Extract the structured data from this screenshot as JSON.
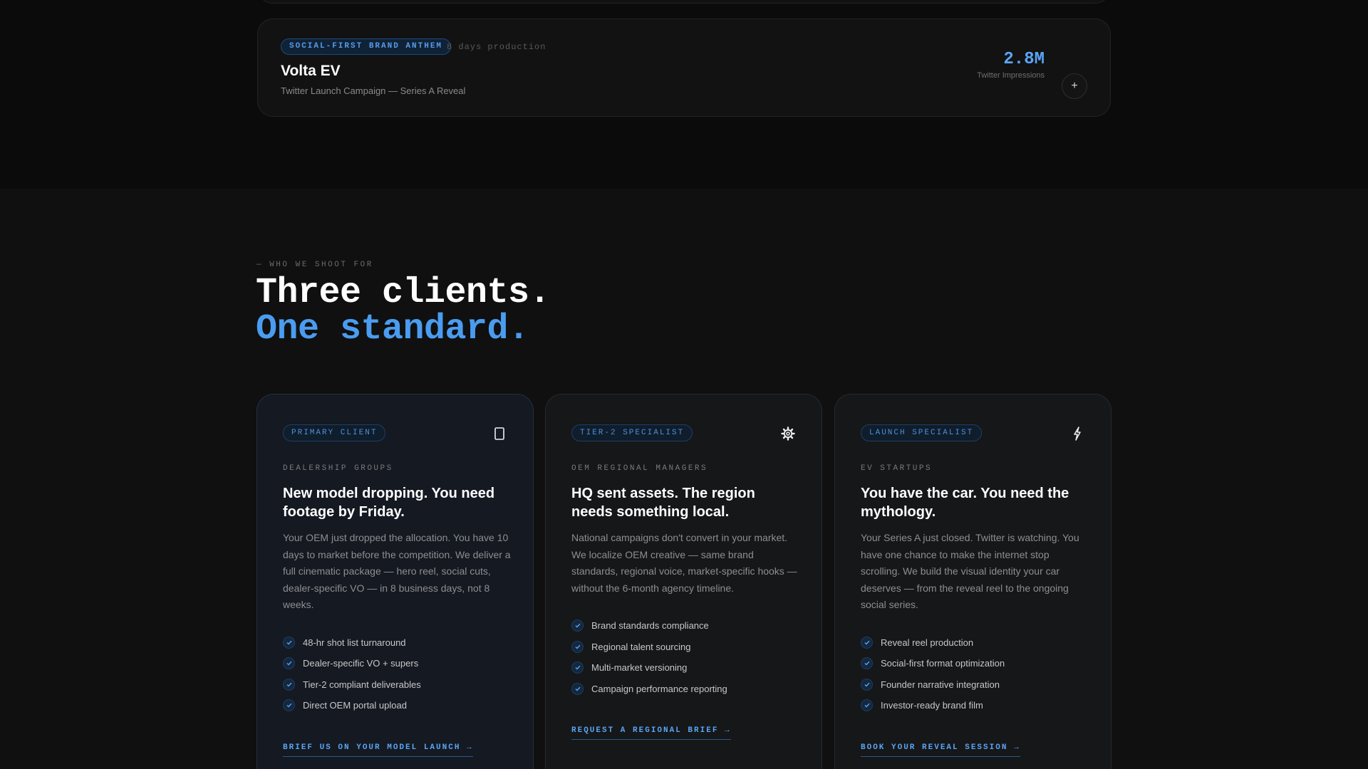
{
  "project": {
    "badge": "SOCIAL-FIRST BRAND ANTHEM",
    "meta": "8 days production",
    "title": "Volta EV",
    "subtitle": "Twitter Launch Campaign — Series A Reveal",
    "metric_value": "2.8M",
    "metric_label": "Twitter Impressions",
    "expand_icon": "plus-icon"
  },
  "section": {
    "eyebrow": "— WHO WE SHOOT FOR",
    "headline_line1": "Three clients.",
    "headline_line2": "One standard.",
    "accent_color": "#4a9cf0"
  },
  "clients": [
    {
      "tag": "PRIMARY CLIENT",
      "icon": "phone-icon",
      "eyebrow": "DEALERSHIP GROUPS",
      "title": "New model dropping. You need footage by Friday.",
      "body": "Your OEM just dropped the allocation. You have 10 days to market before the competition. We deliver a full cinematic package — hero reel, social cuts, dealer-specific VO — in 8 business days, not 8 weeks.",
      "features": [
        "48-hr shot list turnaround",
        "Dealer-specific VO + supers",
        "Tier-2 compliant deliverables",
        "Direct OEM portal upload"
      ],
      "cta": "BRIEF US ON YOUR MODEL LAUNCH →"
    },
    {
      "tag": "TIER-2 SPECIALIST",
      "icon": "gear-icon",
      "eyebrow": "OEM REGIONAL MANAGERS",
      "title": "HQ sent assets. The region needs something local.",
      "body": "National campaigns don't convert in your market. We localize OEM creative — same brand standards, regional voice, market-specific hooks — without the 6-month agency timeline.",
      "features": [
        "Brand standards compliance",
        "Regional talent sourcing",
        "Multi-market versioning",
        "Campaign performance reporting"
      ],
      "cta": "REQUEST A REGIONAL BRIEF →"
    },
    {
      "tag": "LAUNCH SPECIALIST",
      "icon": "lightning-icon",
      "eyebrow": "EV STARTUPS",
      "title": "You have the car. You need the mythology.",
      "body": "Your Series A just closed. Twitter is watching. You have one chance to make the internet stop scrolling. We build the visual identity your car deserves — from the reveal reel to the ongoing social series.",
      "features": [
        "Reveal reel production",
        "Social-first format optimization",
        "Founder narrative integration",
        "Investor-ready brand film"
      ],
      "cta": "BOOK YOUR REVEAL SESSION →"
    }
  ]
}
